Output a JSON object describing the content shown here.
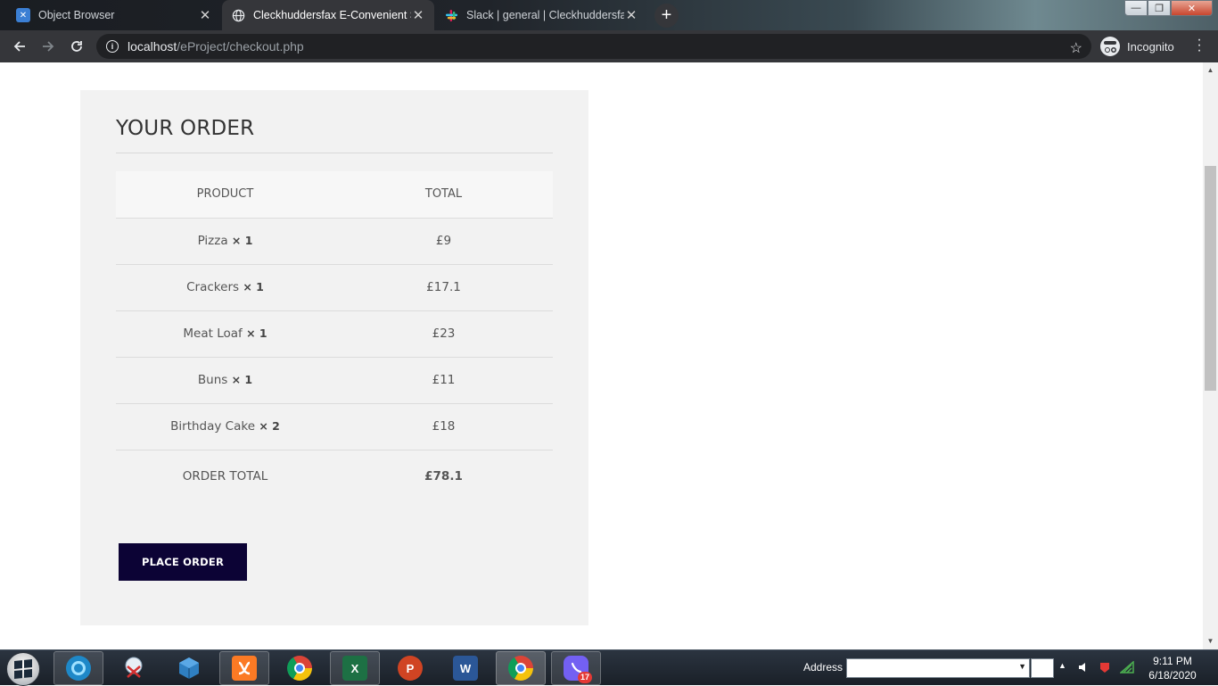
{
  "browser": {
    "tabs": [
      {
        "title": "Object Browser",
        "icon": "object-browser-favicon",
        "active": false
      },
      {
        "title": "Cleckhuddersfax E-Convenient St",
        "icon": "globe-icon",
        "active": true
      },
      {
        "title": "Slack | general | Cleckhuddersfax",
        "icon": "slack-icon",
        "active": false
      }
    ],
    "tab_close": "✕",
    "new_tab": "+",
    "window_controls": {
      "minimize": "—",
      "restore": "❐",
      "close": "✕"
    },
    "url_host": "localhost",
    "url_path": "/eProject/checkout.php",
    "incognito_label": "Incognito",
    "colors": {
      "tab_strip": "#20242a",
      "toolbar": "#35363a",
      "omnibox": "#202124"
    }
  },
  "order": {
    "title": "YOUR ORDER",
    "headers": {
      "product": "PRODUCT",
      "total": "TOTAL"
    },
    "items": [
      {
        "name": "Pizza",
        "qty": "× 1",
        "total": "£9"
      },
      {
        "name": "Crackers",
        "qty": "× 1",
        "total": "£17.1"
      },
      {
        "name": "Meat Loaf",
        "qty": "× 1",
        "total": "£23"
      },
      {
        "name": "Buns",
        "qty": "× 1",
        "total": "£11"
      },
      {
        "name": "Birthday Cake",
        "qty": "× 2",
        "total": "£18"
      }
    ],
    "order_total_label": "ORDER TOTAL",
    "order_total_value": "£78.1",
    "place_order_label": "PLACE ORDER",
    "colors": {
      "panel": "#f2f2f2",
      "button": "#0c0335"
    }
  },
  "taskbar": {
    "apps": [
      "ie-icon",
      "snipping-tool-icon",
      "virtualbox-icon",
      "xampp-icon",
      "chrome-icon",
      "excel-icon",
      "powerpoint-icon",
      "word-icon",
      "chrome-icon",
      "viber-icon"
    ],
    "viber_badge": "17",
    "address_label": "Address",
    "time": "9:11 PM",
    "date": "6/18/2020"
  }
}
